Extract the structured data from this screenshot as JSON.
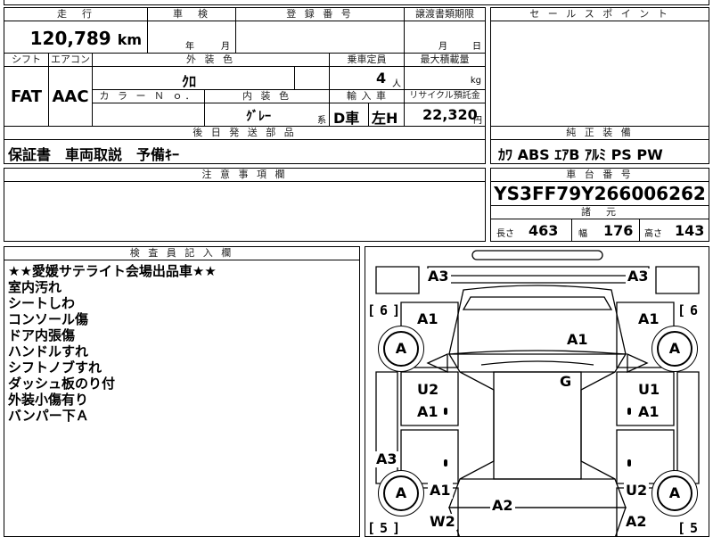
{
  "top_strip": {
    "partial_text_1": "",
    "partial_text_2": ""
  },
  "mileage": {
    "header": "走　行",
    "value": "120,789",
    "unit": "km"
  },
  "inspection": {
    "header": "車　検",
    "year_label": "年",
    "month_label": "月"
  },
  "registration": {
    "header": "登 録 番 号",
    "value": ""
  },
  "transfer_deadline": {
    "header": "譲渡書類期限",
    "month_label": "月",
    "day_label": "日"
  },
  "sales_points": {
    "header": "セ ー ル ス ポ イ ン ト",
    "value": ""
  },
  "shift": {
    "header": "シフト",
    "value": "FAT"
  },
  "aircon": {
    "header": "エアコン",
    "value": "AAC"
  },
  "exterior_color": {
    "header": "外 装 色",
    "value": "ｸﾛ"
  },
  "capacity": {
    "header": "乗車定員",
    "value": "4",
    "unit": "人"
  },
  "max_load": {
    "header": "最大積載量",
    "unit": "kg"
  },
  "color_no": {
    "header": "カ ラ ー Ｎ ｏ．",
    "value": ""
  },
  "interior_color": {
    "header": "内 装 色",
    "value": "ｸﾞﾚｰ",
    "suffix": "系"
  },
  "import": {
    "header": "輸 入 車",
    "value1": "D車",
    "value2": "左H"
  },
  "recycle": {
    "header": "リサイクル預託金",
    "value": "22,320",
    "unit": "円"
  },
  "accessories": {
    "header": "後 日 発 送 部 品",
    "value": "保証書　車両取説　予備ｷｰ"
  },
  "genuine_equipment": {
    "header": "純 正 装 備",
    "value": "ｶﾜ ABS ｴｱB ｱﾙﾐ PS PW"
  },
  "caution": {
    "header": "注 意 事 項 欄",
    "value": ""
  },
  "chassis": {
    "header": "車 台 番 号",
    "value": "YS3FF79Y266006262"
  },
  "dimensions": {
    "header": "諸　元",
    "length_label": "長さ",
    "length": "463",
    "width_label": "幅",
    "width": "176",
    "height_label": "高さ",
    "height": "143"
  },
  "inspector": {
    "header": "検 査 員 記 入 欄",
    "lines": [
      "★★愛媛サテライト会場出品車★★",
      "室内汚れ",
      "シートしわ",
      "コンソール傷",
      "ドア内張傷",
      "ハンドルすれ",
      "シフトノブすれ",
      "ダッシュ板のり付",
      "外装小傷有り",
      "バンパー下Ａ"
    ]
  },
  "damage_map": {
    "marks": {
      "front_left_corner": "A3",
      "front_right_corner": "A3",
      "left_fender": "A1",
      "right_fender": "A1",
      "hood": "A1",
      "roof": "G",
      "left_front_door_1": "U2",
      "left_front_door_2": "A1",
      "right_front_door_1": "U1",
      "right_front_door_2": "A1",
      "left_sill": "A3",
      "left_rear_1": "A1",
      "left_rear_2": "W2",
      "trunk": "A2",
      "right_rear_1": "U2",
      "right_rear_2": "A2"
    },
    "wheels": {
      "front_left": "A",
      "front_right": "A",
      "rear_left": "A",
      "rear_right": "A"
    },
    "tire_front_left": "6",
    "tire_front_right": "6",
    "tire_rear_left": "5",
    "tire_rear_right": "5"
  }
}
